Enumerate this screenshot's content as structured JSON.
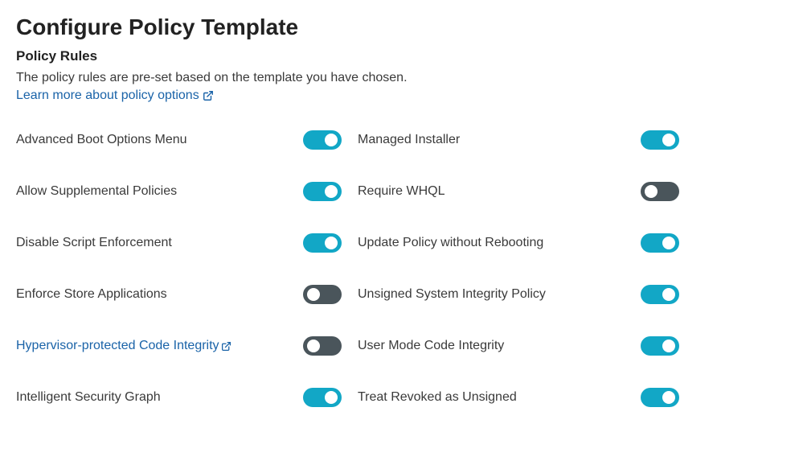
{
  "colors": {
    "accent": "#12a7c6",
    "toggle_off": "#4a555b",
    "link": "#1a63a8",
    "text": "#3a3a3a"
  },
  "header": {
    "title": "Configure Policy Template",
    "subtitle": "Policy Rules",
    "description": "The policy rules are pre-set based on the template you have chosen.",
    "learn_more": "Learn more about policy options",
    "ext_icon": "external-link-icon"
  },
  "rules": {
    "left": [
      {
        "label": "Advanced Boot Options Menu",
        "on": true,
        "link": false
      },
      {
        "label": "Allow Supplemental Policies",
        "on": true,
        "link": false
      },
      {
        "label": "Disable Script Enforcement",
        "on": true,
        "link": false
      },
      {
        "label": "Enforce Store Applications",
        "on": false,
        "link": false
      },
      {
        "label": "Hypervisor-protected Code Integrity",
        "on": false,
        "link": true
      },
      {
        "label": "Intelligent Security Graph",
        "on": true,
        "link": false
      }
    ],
    "right": [
      {
        "label": "Managed Installer",
        "on": true,
        "link": false
      },
      {
        "label": "Require WHQL",
        "on": false,
        "link": false
      },
      {
        "label": "Update Policy without Rebooting",
        "on": true,
        "link": false
      },
      {
        "label": "Unsigned System Integrity Policy",
        "on": true,
        "link": false
      },
      {
        "label": "User Mode Code Integrity",
        "on": true,
        "link": false
      },
      {
        "label": "Treat Revoked as Unsigned",
        "on": true,
        "link": false
      }
    ]
  }
}
